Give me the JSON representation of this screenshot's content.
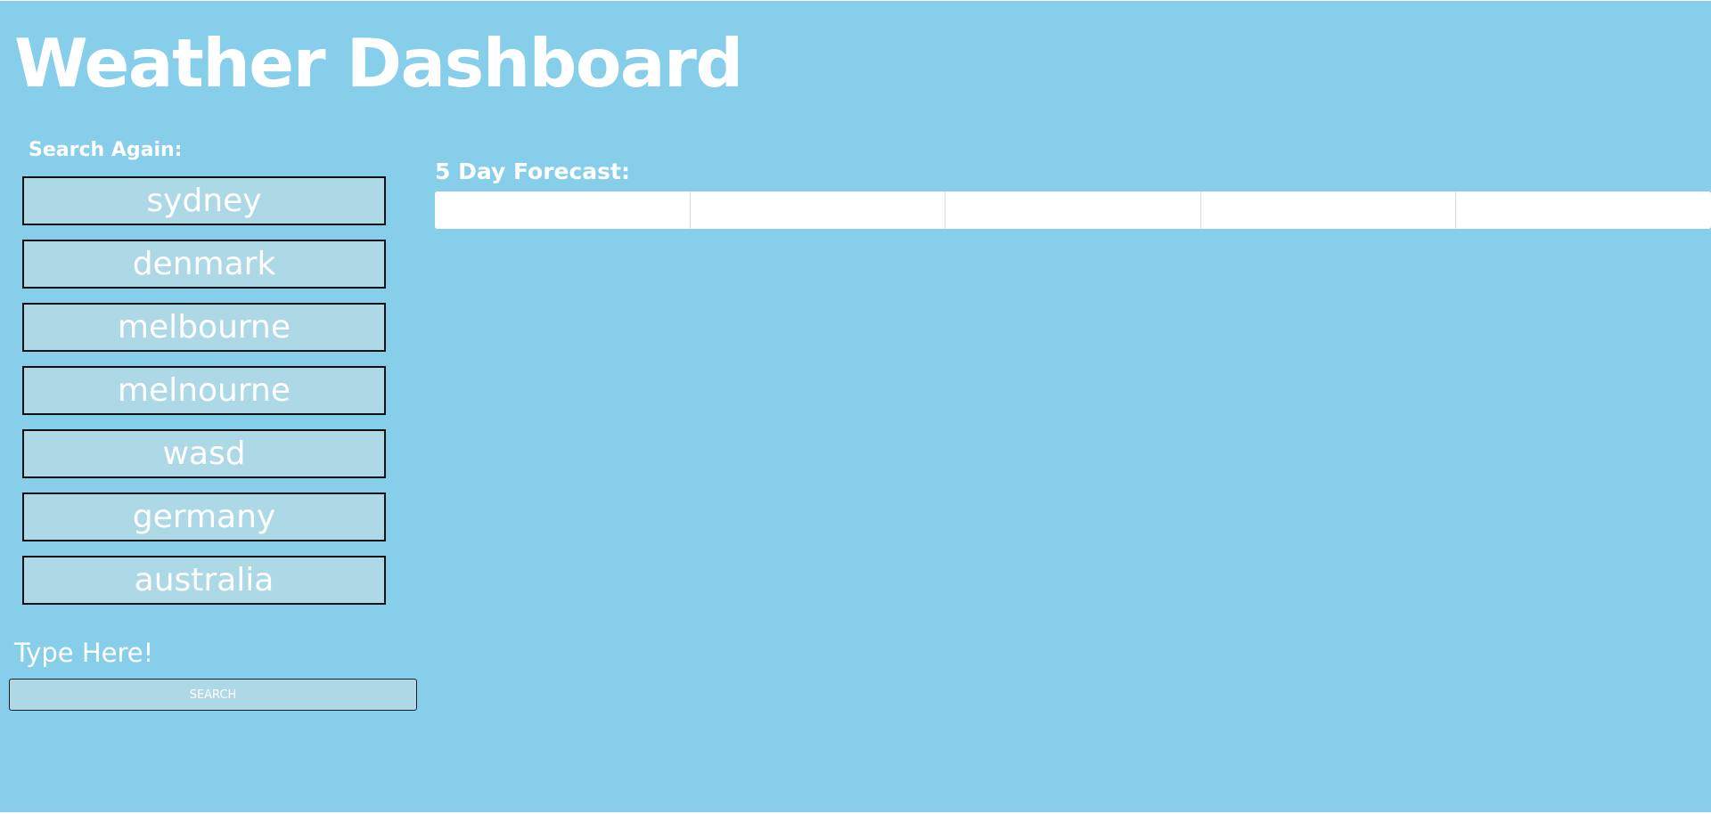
{
  "header": {
    "title": "Weather Dashboard"
  },
  "sidebar": {
    "history_label": "Search Again:",
    "history": [
      "sydney",
      "denmark",
      "melbourne",
      "melnourne",
      "wasd",
      "germany",
      "australia"
    ],
    "input_label": "Type Here!",
    "search_placeholder": "SEARCH"
  },
  "forecast": {
    "label": "5 Day Forecast:",
    "days": [
      "",
      "",
      "",
      "",
      ""
    ]
  },
  "colors": {
    "background": "#87ceeb",
    "button_fill": "#add8e6",
    "text": "#ffffff"
  }
}
